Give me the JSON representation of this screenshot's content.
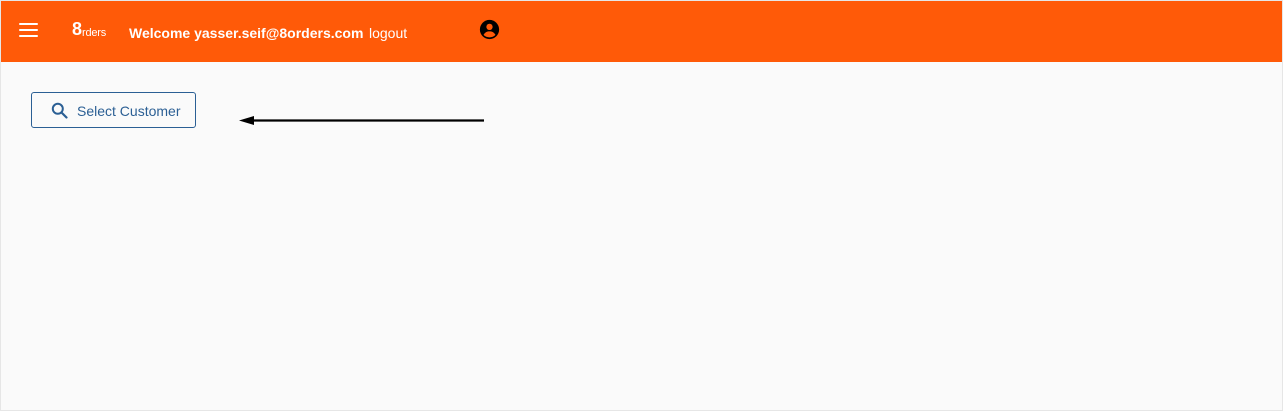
{
  "header": {
    "logo_big": "8",
    "logo_rest": "rders",
    "welcome_text": "Welcome yasser.seif@8orders.com",
    "logout_label": "logout",
    "menu_icon": "hamburger-menu-icon",
    "account_icon": "account-circle-icon"
  },
  "main": {
    "select_customer_label": "Select Customer",
    "select_customer_icon": "search-icon"
  },
  "colors": {
    "header_bg": "#ff5a08",
    "button_border": "#2b5f94",
    "button_text": "#2b5f94",
    "page_bg": "#fafafa",
    "annotation_arrow": "#000000"
  }
}
